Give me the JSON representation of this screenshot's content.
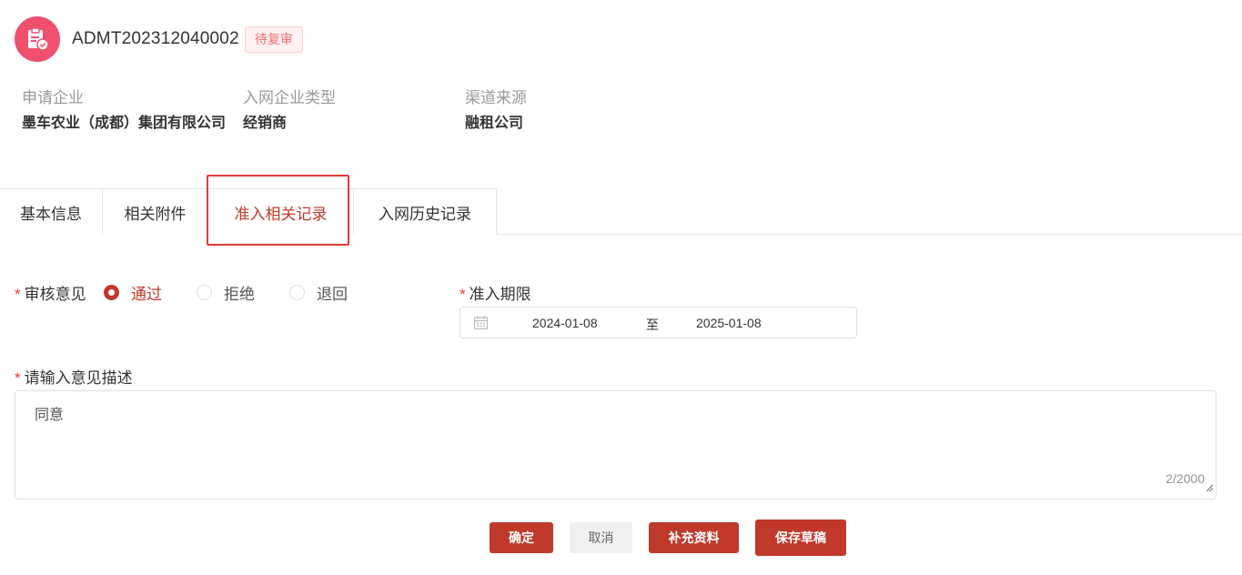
{
  "header": {
    "icon": "clipboard-check-icon",
    "order_id": "ADMT202312040002",
    "status": "待复审",
    "accent": "#f0506e"
  },
  "info": [
    {
      "label": "申请企业",
      "value": "墨车农业（成都）集团有限公司"
    },
    {
      "label": "入网企业类型",
      "value": "经销商"
    },
    {
      "label": "渠道来源",
      "value": "融租公司"
    }
  ],
  "tabs": [
    {
      "label": "基本信息",
      "active": false
    },
    {
      "label": "相关附件",
      "active": false
    },
    {
      "label": "准入相关记录",
      "active": true
    },
    {
      "label": "入网历史记录",
      "active": false
    }
  ],
  "form": {
    "review_label": "审核意见",
    "options": [
      {
        "label": "通过",
        "checked": true
      },
      {
        "label": "拒绝",
        "checked": false
      },
      {
        "label": "退回",
        "checked": false
      }
    ],
    "period_label": "准入期限",
    "date_start": "2024-01-08",
    "date_sep": "至",
    "date_end": "2025-01-08",
    "desc_label": "请输入意见描述",
    "desc_value": "同意",
    "word_count": "2/2000"
  },
  "buttons": {
    "confirm": "确定",
    "cancel": "取消",
    "supplement": "补充资料",
    "save_draft": "保存草稿"
  },
  "colors": {
    "primary": "#c0392b",
    "required": "#e53935",
    "highlight_box": "#e53935"
  }
}
